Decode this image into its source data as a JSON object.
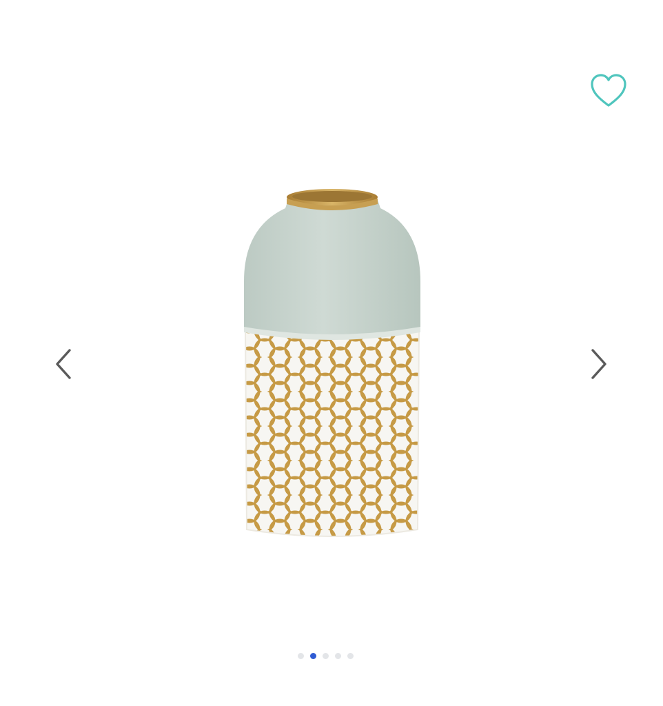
{
  "gallery": {
    "total_images": 5,
    "active_index": 1,
    "icons": {
      "wishlist": "heart-outline-icon",
      "prev": "chevron-left-icon",
      "next": "chevron-right-icon"
    },
    "colors": {
      "wishlist_heart": "#4fc5bd",
      "arrow": "#5a5a5a",
      "dot_active": "#2f5bd3",
      "dot_inactive": "#e3e5e8",
      "vase_top": "#c9d5cf",
      "vase_gold": "#c69a45",
      "vase_white": "#f7f6f2"
    }
  }
}
